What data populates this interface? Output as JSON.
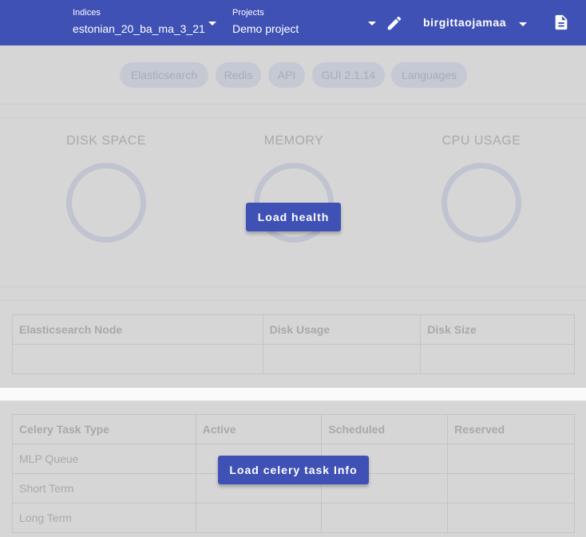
{
  "header": {
    "indices": {
      "label": "Indices",
      "value": "estonian_20_ba_ma_3_21"
    },
    "projects": {
      "label": "Projects",
      "value": "Demo project"
    },
    "username": "birgittaojamaa",
    "icons": [
      "chevron-down-icon",
      "pencil-icon",
      "document-icon"
    ],
    "bar_color": "#3f51b5"
  },
  "chips": [
    "Elasticsearch",
    "Redis",
    "API",
    "GUI 2.1.14",
    "Languages"
  ],
  "health": {
    "gauges": [
      {
        "title": "DISK SPACE"
      },
      {
        "title": "MEMORY"
      },
      {
        "title": "CPU USAGE"
      }
    ],
    "load_button": "Load health"
  },
  "node_table": {
    "headers": [
      "Elasticsearch Node",
      "Disk Usage",
      "Disk Size"
    ],
    "rows": [
      [
        "",
        "",
        ""
      ]
    ]
  },
  "celery_table": {
    "headers": [
      "Celery Task Type",
      "Active",
      "Scheduled",
      "Reserved"
    ],
    "rows": [
      [
        "MLP Queue",
        "",
        "",
        ""
      ],
      [
        "Short Term",
        "",
        "",
        ""
      ],
      [
        "Long Term",
        "",
        "",
        ""
      ]
    ],
    "load_button": "Load celery task Info"
  }
}
